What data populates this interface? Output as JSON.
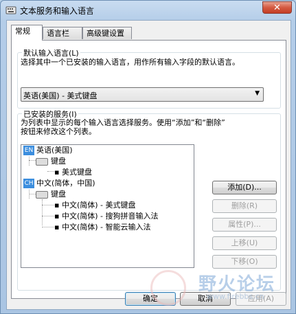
{
  "window": {
    "title": "文本服务和输入语言",
    "close_glyph": "✕"
  },
  "tabs": [
    {
      "label": "常规"
    },
    {
      "label": "语言栏"
    },
    {
      "label": "高级键设置"
    }
  ],
  "default_language": {
    "title": "默认输入语言(L)",
    "description": "选择其中一个已安装的输入语言，用作所有输入字段的默认语言。",
    "selected": "英语(美国) - 美式键盘"
  },
  "installed_services": {
    "title": "已安装的服务(I)",
    "description_line1": "为列表中显示的每个输入语言选择服务。使用“添加”和“删除”",
    "description_line2": "按钮来修改这个列表。",
    "tree": {
      "en": {
        "badge": "EN",
        "label": "英语(美国)",
        "keyboard_label": "键盘",
        "items": [
          "美式键盘"
        ]
      },
      "ch": {
        "badge": "CH",
        "label": "中文(简体，中国)",
        "keyboard_label": "键盘",
        "items": [
          "中文(简体) - 美式键盘",
          "中文(简体) - 搜狗拼音输入法",
          "中文(简体) - 智能云输入法"
        ]
      }
    },
    "buttons": {
      "add": "添加(D)...",
      "remove": "删除(R)",
      "properties": "属性(P)...",
      "move_up": "上移(U)",
      "move_down": "下移(O)"
    }
  },
  "footer": {
    "ok": "确定",
    "cancel": "取消",
    "apply": "应用(A)"
  },
  "watermark": {
    "text": "野火论坛",
    "url": "www.firebbs.cn"
  }
}
